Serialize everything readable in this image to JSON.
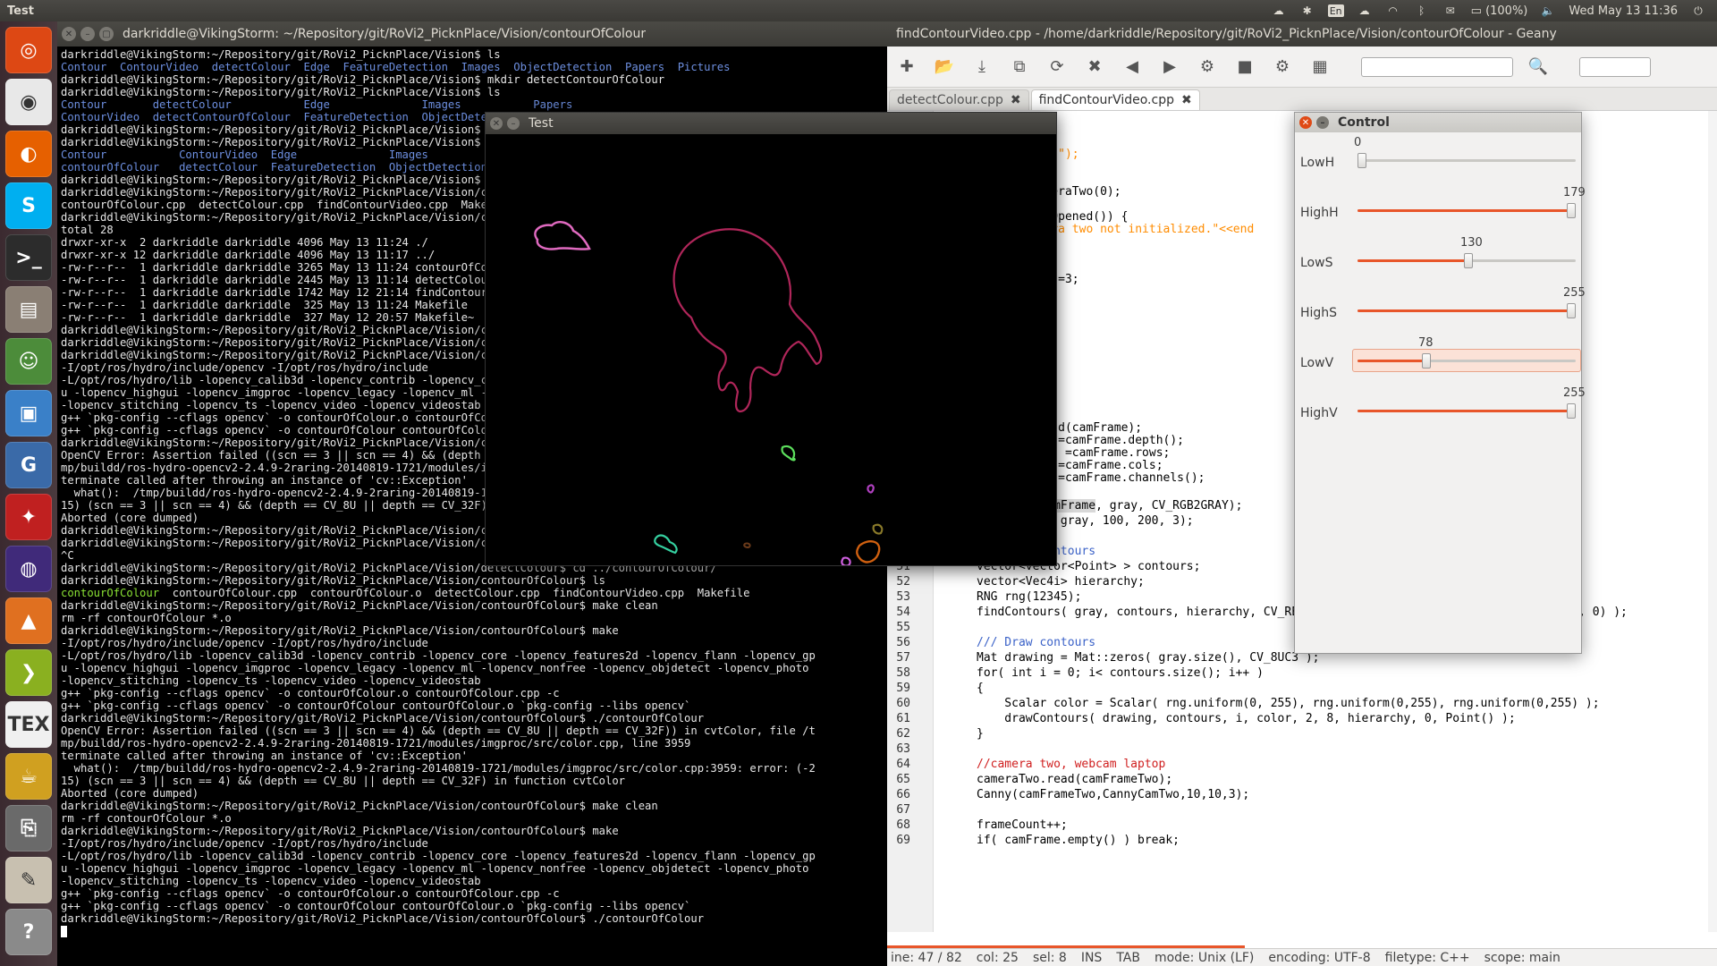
{
  "topbar": {
    "app_name": "Test",
    "lang": "En",
    "battery": "(100%)",
    "clock": "Wed May 13 11:36"
  },
  "launcher": {
    "items": [
      "ubuntu-icon",
      "chrome-icon",
      "firefox-icon",
      "skype-icon",
      "terminal-icon",
      "files-icon",
      "android-icon",
      "cube-icon",
      "g-icon",
      "red-bird-icon",
      "eclipse-icon",
      "matlab-icon",
      "arrow-icon",
      "tex-icon",
      "pot-icon",
      "usb-icon",
      "editor-icon",
      "help-icon"
    ]
  },
  "terminal": {
    "title": "darkriddle@VikingStorm: ~/Repository/git/RoVi2_PicknPlace/Vision/contourOfColour",
    "lines": [
      "darkriddle@VikingStorm:~/Repository/git/RoVi2_PicknPlace/Vision$ ls",
      "@@Contour  ContourVideo  detectColour  Edge  FeatureDetection  Images  ObjectDetection  Papers  Pictures",
      "darkriddle@VikingStorm:~/Repository/git/RoVi2_PicknPlace/Vision$ mkdir detectContourOfColour",
      "darkriddle@VikingStorm:~/Repository/git/RoVi2_PicknPlace/Vision$ ls",
      "@@Contour       detectColour           Edge              Images           Papers",
      "@@ContourVideo  detectContourOfColour  FeatureDetection  ObjectDetection  Pictures",
      "darkriddle@VikingStorm:~/Repository/git/RoVi2_PicknPlace/Vision$ mv detectContourOfColour contourOfColour",
      "darkriddle@VikingStorm:~/Repository/git/RoVi2_PicknPlace/Vision$ ls",
      "@@Contour           ContourVideo  Edge              Images           Papers",
      "@@contourOfColour   detectColour  FeatureDetection  ObjectDetection  Pictures",
      "darkriddle@VikingStorm:~/Repository/git/RoVi2_PicknPlace/Vision$ cd contourOfColour/",
      "darkriddle@VikingStorm:~/Repository/git/RoVi2_PicknPlace/Vision/contourOfColour$ ls",
      "contourOfColour.cpp  detectColour.cpp  findContourVideo.cpp  Makefile",
      "darkriddle@VikingStorm:~/Repository/git/RoVi2_PicknPlace/Vision/contourOfColour$ ls -la",
      "total 28",
      "drwxr-xr-x  2 darkriddle darkriddle 4096 May 13 11:24 ./",
      "drwxr-xr-x 12 darkriddle darkriddle 4096 May 13 11:17 ../",
      "-rw-r--r--  1 darkriddle darkriddle 3265 May 13 11:24 contourOfColour.cpp",
      "-rw-r--r--  1 darkriddle darkriddle 2445 May 13 11:14 detectColour.cpp",
      "-rw-r--r--  1 darkriddle darkriddle 1742 May 12 21:14 findContourVideo.cpp",
      "-rw-r--r--  1 darkriddle darkriddle  325 May 13 11:24 Makefile",
      "-rw-r--r--  1 darkriddle darkriddle  327 May 12 20:57 Makefile~",
      "darkriddle@VikingStorm:~/Repository/git/RoVi2_PicknPlace/Vision/contourOfColour$ make",
      "darkriddle@VikingStorm:~/Repository/git/RoVi2_PicknPlace/Vision/contourOfColour$ make",
      "darkriddle@VikingStorm:~/Repository/git/RoVi2_PicknPlace/Vision/contourOfColour$ make",
      "-I/opt/ros/hydro/include/opencv -I/opt/ros/hydro/include",
      "-L/opt/ros/hydro/lib -lopencv_calib3d -lopencv_contrib -lopencv_core -lopencv_features2d",
      "u -lopencv_highgui -lopencv_imgproc -lopencv_legacy -lopencv_ml -lopencv_nonfree",
      "-lopencv_stitching -lopencv_ts -lopencv_video -lopencv_videostab",
      "g++ `pkg-config --cflags opencv` -o contourOfColour.o contourOfColour.cpp -c",
      "g++ `pkg-config --cflags opencv` -o contourOfColour contourOfColour.o",
      "darkriddle@VikingStorm:~/Repository/git/RoVi2_PicknPlace/Vision/contourOfColour$ ./contourOfColour",
      "OpenCV Error: Assertion failed ((scn == 3 || scn == 4) && (depth == CV_8U || depth == CV_32F))",
      "mp/buildd/ros-hydro-opencv2-2.4.9-2raring-20140819-1721/modules/imgproc/src/color.cpp",
      "terminate called after throwing an instance of 'cv::Exception'",
      "  what():  /tmp/buildd/ros-hydro-opencv2-2.4.9-2raring-20140819-1721/modules/imgproc",
      "15) (scn == 3 || scn == 4) && (depth == CV_8U || depth == CV_32F) in function cvtColor",
      "",
      "Aborted (core dumped)",
      "darkriddle@VikingStorm:~/Repository/git/RoVi2_PicknPlace/Vision/contourOfColour$",
      "darkriddle@VikingStorm:~/Repository/git/RoVi2_PicknPlace/Vision/contourOfColour$",
      "^C",
      "darkriddle@VikingStorm:~/Repository/git/RoVi2_PicknPlace/Vision/detectColour$ cd ../contourOfColour/",
      "darkriddle@VikingStorm:~/Repository/git/RoVi2_PicknPlace/Vision/contourOfColour$ ls",
      "##contourOfColour##  contourOfColour.cpp  contourOfColour.o  detectColour.cpp  findContourVideo.cpp  Makefile",
      "darkriddle@VikingStorm:~/Repository/git/RoVi2_PicknPlace/Vision/contourOfColour$ make clean",
      "rm -rf contourOfColour *.o",
      "darkriddle@VikingStorm:~/Repository/git/RoVi2_PicknPlace/Vision/contourOfColour$ make",
      "-I/opt/ros/hydro/include/opencv -I/opt/ros/hydro/include",
      "-L/opt/ros/hydro/lib -lopencv_calib3d -lopencv_contrib -lopencv_core -lopencv_features2d -lopencv_flann -lopencv_gp",
      "u -lopencv_highgui -lopencv_imgproc -lopencv_legacy -lopencv_ml -lopencv_nonfree -lopencv_objdetect -lopencv_photo",
      "-lopencv_stitching -lopencv_ts -lopencv_video -lopencv_videostab",
      "g++ `pkg-config --cflags opencv` -o contourOfColour.o contourOfColour.cpp -c",
      "g++ `pkg-config --cflags opencv` -o contourOfColour contourOfColour.o `pkg-config --libs opencv`",
      "darkriddle@VikingStorm:~/Repository/git/RoVi2_PicknPlace/Vision/contourOfColour$ ./contourOfColour",
      "OpenCV Error: Assertion failed ((scn == 3 || scn == 4) && (depth == CV_8U || depth == CV_32F)) in cvtColor, file /t",
      "mp/buildd/ros-hydro-opencv2-2.4.9-2raring-20140819-1721/modules/imgproc/src/color.cpp, line 3959",
      "terminate called after throwing an instance of 'cv::Exception'",
      "  what():  /tmp/buildd/ros-hydro-opencv2-2.4.9-2raring-20140819-1721/modules/imgproc/src/color.cpp:3959: error: (-2",
      "15) (scn == 3 || scn == 4) && (depth == CV_8U || depth == CV_32F) in function cvtColor",
      "",
      "Aborted (core dumped)",
      "darkriddle@VikingStorm:~/Repository/git/RoVi2_PicknPlace/Vision/contourOfColour$ make clean",
      "rm -rf contourOfColour *.o",
      "darkriddle@VikingStorm:~/Repository/git/RoVi2_PicknPlace/Vision/contourOfColour$ make",
      "-I/opt/ros/hydro/include/opencv -I/opt/ros/hydro/include",
      "-L/opt/ros/hydro/lib -lopencv_calib3d -lopencv_contrib -lopencv_core -lopencv_features2d -lopencv_flann -lopencv_gp",
      "u -lopencv_highgui -lopencv_imgproc -lopencv_legacy -lopencv_ml -lopencv_nonfree -lopencv_objdetect -lopencv_photo",
      "-lopencv_stitching -lopencv_ts -lopencv_video -lopencv_videostab",
      "g++ `pkg-config --cflags opencv` -o contourOfColour.o contourOfColour.cpp -c",
      "g++ `pkg-config --cflags opencv` -o contourOfColour contourOfColour.o `pkg-config --libs opencv`",
      "darkriddle@VikingStorm:~/Repository/git/RoVi2_PicknPlace/Vision/contourOfColour$ ./contourOfColour"
    ]
  },
  "geany": {
    "title": "findContourVideo.cpp - /home/darkriddle/Repository/git/RoVi2_PicknPlace/Vision/contourOfColour - Geany",
    "tabs": [
      {
        "label": "detectColour.cpp"
      },
      {
        "label": "findContourVideo.cpp"
      }
    ],
    "active_tab": 1,
    "partial_lines": [
      {
        "text": "ar**)"
      },
      {
        "text": "\"Test\");",
        "cls": "st"
      },
      {
        "text": "nt=0;"
      },
      {
        "text": " cameraTwo(0);"
      },
      {
        "text": "o.isOpened()) {"
      },
      {
        "text": "Camera two not initialized.\"<<end",
        "cls": "st"
      },
      {
        "text": "ength=3;"
      },
      {
        "text": "wo;"
      },
      {
        "text": "wo;"
      },
      {
        "text": "o.read(camFrame);"
      },
      {
        "text": "_img =camFrame.depth();"
      },
      {
        "text": "t_img =camFrame.rows;"
      },
      {
        "text": "_img =camFrame.cols;"
      },
      {
        "text": "_img =camFrame.channels();"
      }
    ],
    "code_lines": [
      {
        "num": "46",
        "text": ""
      },
      {
        "num": "47",
        "text": "        cvtColor(camFrame, gray, CV_RGB2GRAY);"
      },
      {
        "num": "48",
        "text": "        Canny(gray, gray, 100, 200, 3);"
      },
      {
        "num": "49",
        "text": ""
      },
      {
        "num": "50",
        "text": "        /// Find contours",
        "cls": "cm"
      },
      {
        "num": "51",
        "text": "        vector<vector<Point> > contours;"
      },
      {
        "num": "52",
        "text": "        vector<Vec4i> hierarchy;"
      },
      {
        "num": "53",
        "text": "        RNG rng(12345);"
      },
      {
        "num": "54",
        "text": "        findContours( gray, contours, hierarchy, CV_RETR_TREE, CV_CHAIN_APPROX_SIMPLE, Point(0, 0) );"
      },
      {
        "num": "55",
        "text": ""
      },
      {
        "num": "56",
        "text": "        /// Draw contours",
        "cls": "cm"
      },
      {
        "num": "57",
        "text": "        Mat drawing = Mat::zeros( gray.size(), CV_8UC3 );"
      },
      {
        "num": "58",
        "text": "        for( int i = 0; i< contours.size(); i++ )"
      },
      {
        "num": "59",
        "text": "        {"
      },
      {
        "num": "60",
        "text": "            Scalar color = Scalar( rng.uniform(0, 255), rng.uniform(0,255), rng.uniform(0,255) );"
      },
      {
        "num": "61",
        "text": "            drawContours( drawing, contours, i, color, 2, 8, hierarchy, 0, Point() );"
      },
      {
        "num": "62",
        "text": "        }"
      },
      {
        "num": "63",
        "text": ""
      },
      {
        "num": "64",
        "text": "        //camera two, webcam laptop",
        "cls": "cmr"
      },
      {
        "num": "65",
        "text": "        cameraTwo.read(camFrameTwo);"
      },
      {
        "num": "66",
        "text": "        Canny(camFrameTwo,CannyCamTwo,10,10,3);"
      },
      {
        "num": "67",
        "text": ""
      },
      {
        "num": "68",
        "text": "        frameCount++;"
      },
      {
        "num": "69",
        "text": "        if( camFrame.empty() ) break;"
      }
    ],
    "status": {
      "line": "ine: 47 / 82",
      "col": "col: 25",
      "sel": "sel: 8",
      "ins": "INS",
      "tab": "TAB",
      "mode": "mode: Unix (LF)",
      "encoding": "encoding: UTF-8",
      "filetype": "filetype: C++",
      "scope": "scope: main"
    }
  },
  "test_window": {
    "title": "Test"
  },
  "control": {
    "title": "Control",
    "sliders": [
      {
        "label": "LowH",
        "value": "0",
        "level": 0.0
      },
      {
        "label": "HighH",
        "value": "179",
        "level": 1.0
      },
      {
        "label": "LowS",
        "value": "130",
        "level": 0.51
      },
      {
        "label": "HighS",
        "value": "255",
        "level": 1.0
      },
      {
        "label": "LowV",
        "value": "78",
        "level": 0.306
      },
      {
        "label": "HighV",
        "value": "255",
        "level": 1.0
      }
    ]
  }
}
